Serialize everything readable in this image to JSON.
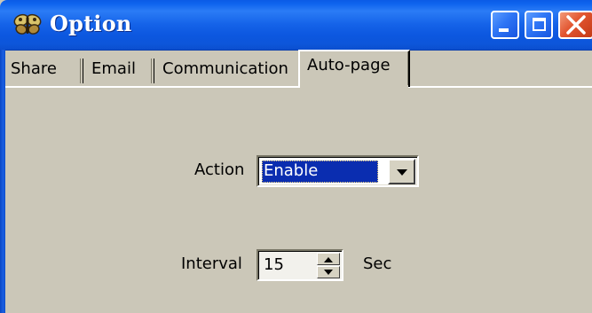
{
  "window": {
    "title": "Option",
    "app_icon": "butterfly-icon",
    "controls": [
      "minimize-icon",
      "maximize-icon",
      "close-icon"
    ],
    "accent_color": "#0a5be6",
    "close_color": "#e2552f"
  },
  "tabs": [
    {
      "label": "Share",
      "active": false
    },
    {
      "label": "Email",
      "active": false
    },
    {
      "label": "Communication",
      "active": false
    },
    {
      "label": "Auto-page",
      "active": true
    }
  ],
  "auto_page": {
    "action_label": "Action",
    "action_value": "Enable",
    "interval_label": "Interval",
    "interval_value": "15",
    "interval_unit": "Sec"
  }
}
